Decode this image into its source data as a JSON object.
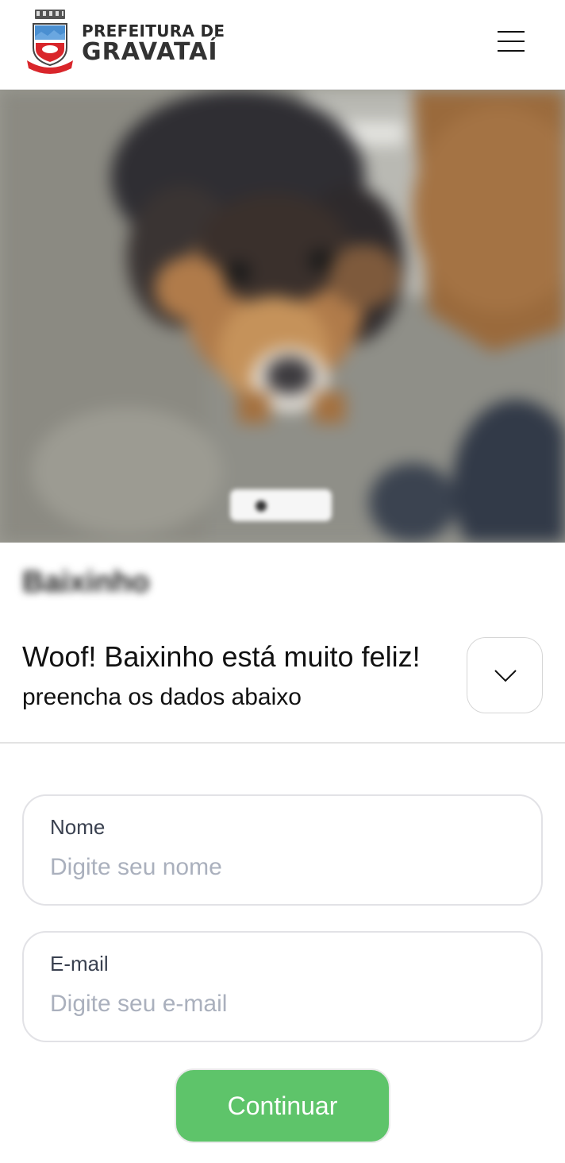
{
  "header": {
    "brand_line1": "PREFEITURA DE",
    "brand_line2": "GRAVATAÍ",
    "logo_icon": "city-crest-icon",
    "menu_icon": "hamburger-menu-icon"
  },
  "hero": {
    "slide_count": 1,
    "active_slide": 1
  },
  "pet": {
    "name": "Baixinho"
  },
  "status": {
    "headline": "Woof! Baixinho está muito feliz!",
    "subline": "preencha os dados abaixo",
    "toggle_icon": "chevron-down-icon"
  },
  "form": {
    "name_label": "Nome",
    "name_placeholder": "Digite seu nome",
    "name_value": "",
    "email_label": "E-mail",
    "email_placeholder": "Digite seu e-mail",
    "email_value": "",
    "submit_label": "Continuar"
  },
  "colors": {
    "accent_green": "#5ec46a",
    "border_gray": "#e2e2e6",
    "placeholder_gray": "#aab0bd"
  }
}
